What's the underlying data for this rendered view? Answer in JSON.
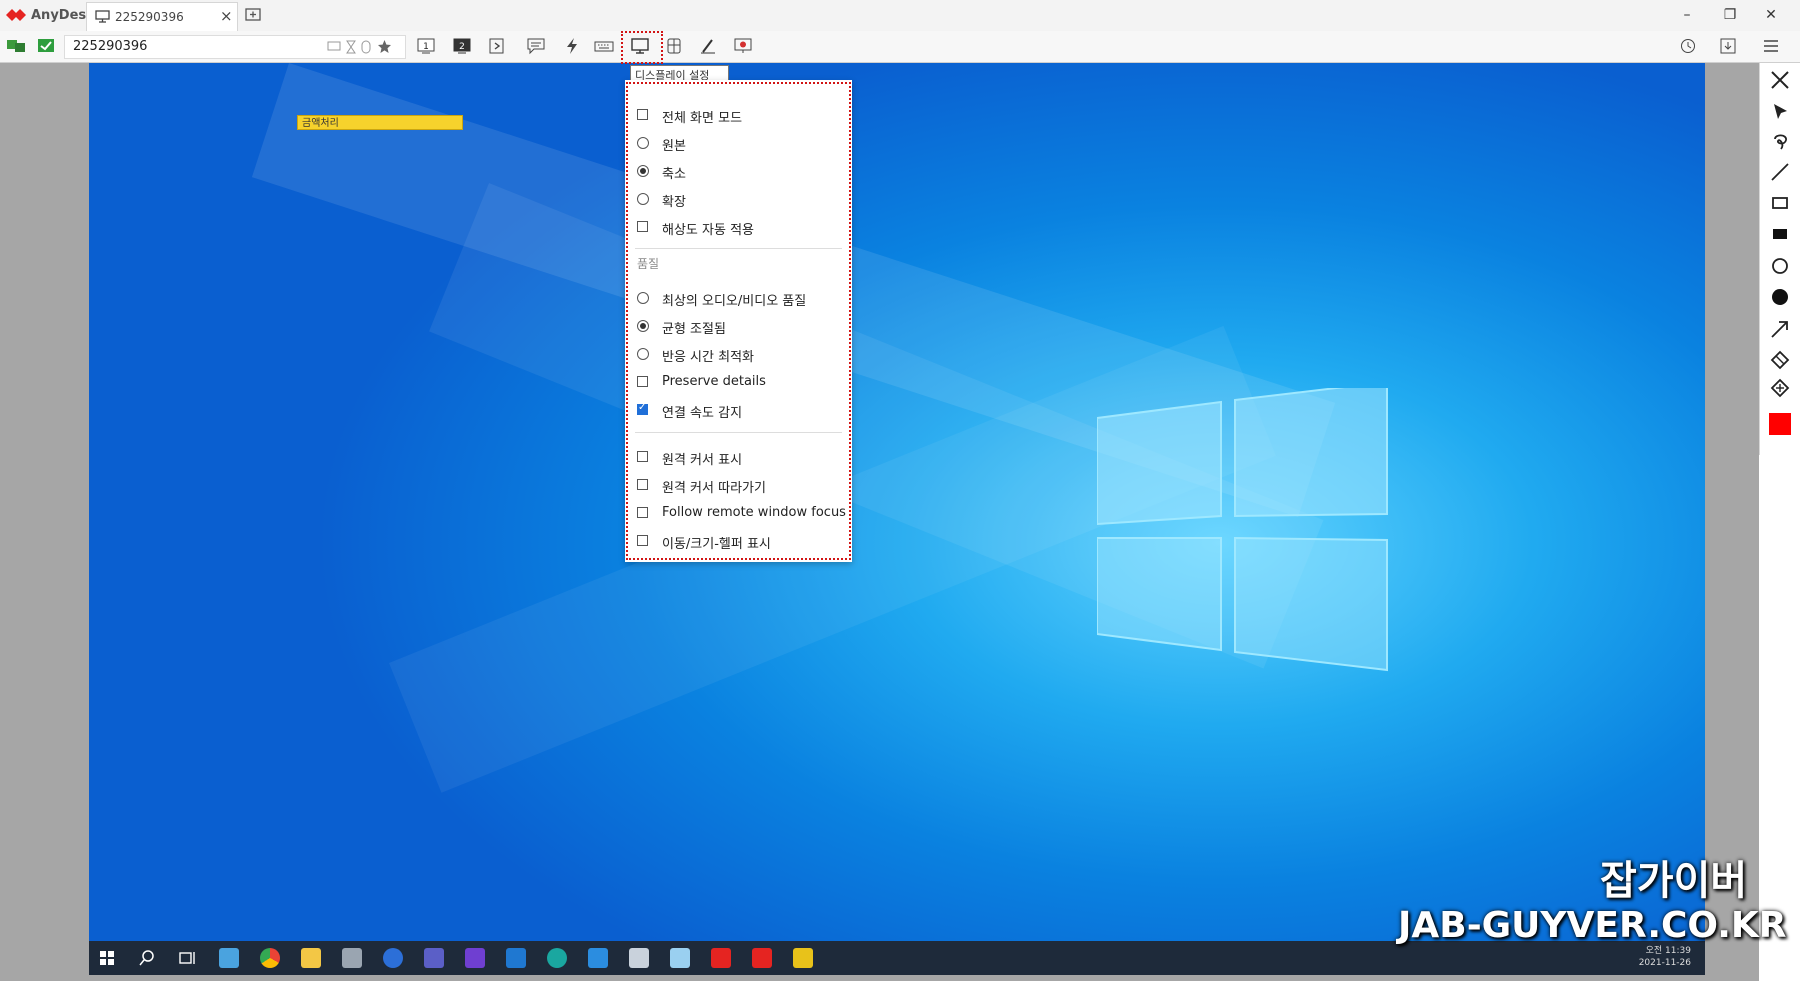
{
  "title_bar": {
    "app_name": "AnyDesk",
    "tab_label": "225290396",
    "tab_close": "×",
    "window_controls": [
      "–",
      "❐",
      "✕"
    ]
  },
  "toolbar": {
    "address_value": "225290396",
    "icons": [
      "monitor-1-icon",
      "monitor-2-icon",
      "file-transfer-icon",
      "chat-icon",
      "actions-icon",
      "keyboard-icon",
      "display-settings-icon",
      "input-icon",
      "whiteboard-icon",
      "record-icon"
    ],
    "monitor_labels": [
      "1",
      "2"
    ],
    "right_icons": [
      "history-icon",
      "download-icon",
      "menu-icon"
    ]
  },
  "tooltip": {
    "text": "디스플레이 설정"
  },
  "display_menu": {
    "view_items": [
      {
        "type": "checkbox",
        "label": "전체 화면 모드",
        "checked": false
      },
      {
        "type": "radio",
        "label": "원본",
        "checked": false
      },
      {
        "type": "radio",
        "label": "축소",
        "checked": true
      },
      {
        "type": "radio",
        "label": "확장",
        "checked": false
      },
      {
        "type": "checkbox",
        "label": "해상도 자동 적용",
        "checked": false
      }
    ],
    "quality_section_label": "품질",
    "quality_items": [
      {
        "type": "radio",
        "label": "최상의 오디오/비디오 품질",
        "checked": false
      },
      {
        "type": "radio",
        "label": "균형 조절됨",
        "checked": true
      },
      {
        "type": "radio",
        "label": "반응 시간 최적화",
        "checked": false
      },
      {
        "type": "checkbox",
        "label": "Preserve details",
        "checked": false
      },
      {
        "type": "checkbox",
        "label": "연결 속도 감지",
        "checked": true
      }
    ],
    "cursor_items": [
      {
        "type": "checkbox",
        "label": "원격 커서 표시",
        "checked": false
      },
      {
        "type": "checkbox",
        "label": "원격 커서 따라가기",
        "checked": false
      },
      {
        "type": "checkbox",
        "label": "Follow remote window focus",
        "checked": false
      },
      {
        "type": "checkbox",
        "label": "이동/크기-헬퍼 표시",
        "checked": false
      }
    ]
  },
  "remote_desktop": {
    "highlight_label": "금액처리",
    "taskbar_icons": [
      "start-icon",
      "search-icon",
      "task-view-icon",
      "app-icon",
      "chrome-icon",
      "explorer-icon",
      "app-icon",
      "m-app-icon",
      "teams-icon",
      "u-app-icon",
      "outlook-icon",
      "edge-icon",
      "app-icon",
      "app-icon",
      "app-icon",
      "anydesk-icon",
      "anydesk-icon",
      "app-icon"
    ],
    "tray_time": "오전 11:39",
    "tray_date": "2021-11-26"
  },
  "draw_tools": [
    "close-icon",
    "pointer-icon",
    "lasso-icon",
    "line-icon",
    "rectangle-icon",
    "filled-rectangle-icon",
    "circle-icon",
    "filled-circle-icon",
    "arrow-icon",
    "eraser-icon",
    "clear-icon",
    "color-swatch"
  ],
  "colors": {
    "accent_red": "#e52421",
    "swatch": "#ff0000",
    "desktop_blue": "#0a82e0"
  },
  "watermark": {
    "line1": "잡가이버",
    "line2": "JAB-GUYVER.CO.KR"
  }
}
